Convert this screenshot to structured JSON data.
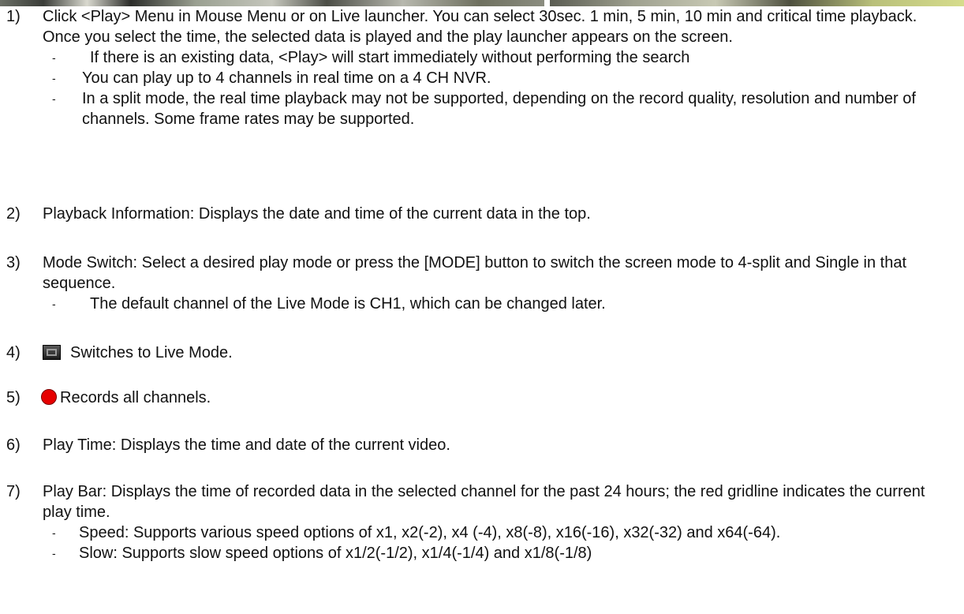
{
  "items": [
    {
      "num": "1)",
      "text": "Click <Play> Menu in Mouse Menu or on Live launcher. You can select 30sec. 1 min, 5 min, 10 min and critical time playback. Once you select the time, the selected data is played and the play launcher appears on the screen.",
      "subs": [
        "If there is an existing data, <Play> will start immediately without performing the search",
        "You can play up to 4 channels in real time on a 4 CH NVR.",
        "In a split mode, the real time playback may not be supported, depending on the record quality, resolution and number of channels. Some frame rates may be supported."
      ]
    },
    {
      "num": "2)",
      "text": "Playback Information: Displays the date and time of the current data in the top."
    },
    {
      "num": "3)",
      "text": "Mode Switch: Select a desired play mode or press the [MODE] button to switch the screen mode to 4-split and Single in that sequence.",
      "subs": [
        "The default channel of the Live Mode is CH1, which can be changed later."
      ]
    },
    {
      "num": "4)",
      "text": "Switches to Live Mode.",
      "icon": "live-mode-icon"
    },
    {
      "num": "5)",
      "text": "Records all channels.",
      "icon": "record-icon"
    },
    {
      "num": "6)",
      "text": "Play Time: Displays the time and date of the current video."
    },
    {
      "num": "7)",
      "text": "Play Bar: Displays the time of recorded data in the selected channel for the past 24 hours; the red gridline indicates the current play time.",
      "subs": [
        "Speed: Supports various speed options of x1, x2(-2), x4 (-4), x8(-8), x16(-16), x32(-32) and x64(-64).",
        "Slow: Supports slow speed options of x1/2(-1/2), x1/4(-1/4) and x1/8(-1/8)"
      ]
    }
  ],
  "colors": {
    "record_icon": "#e60000",
    "text": "#111111"
  }
}
